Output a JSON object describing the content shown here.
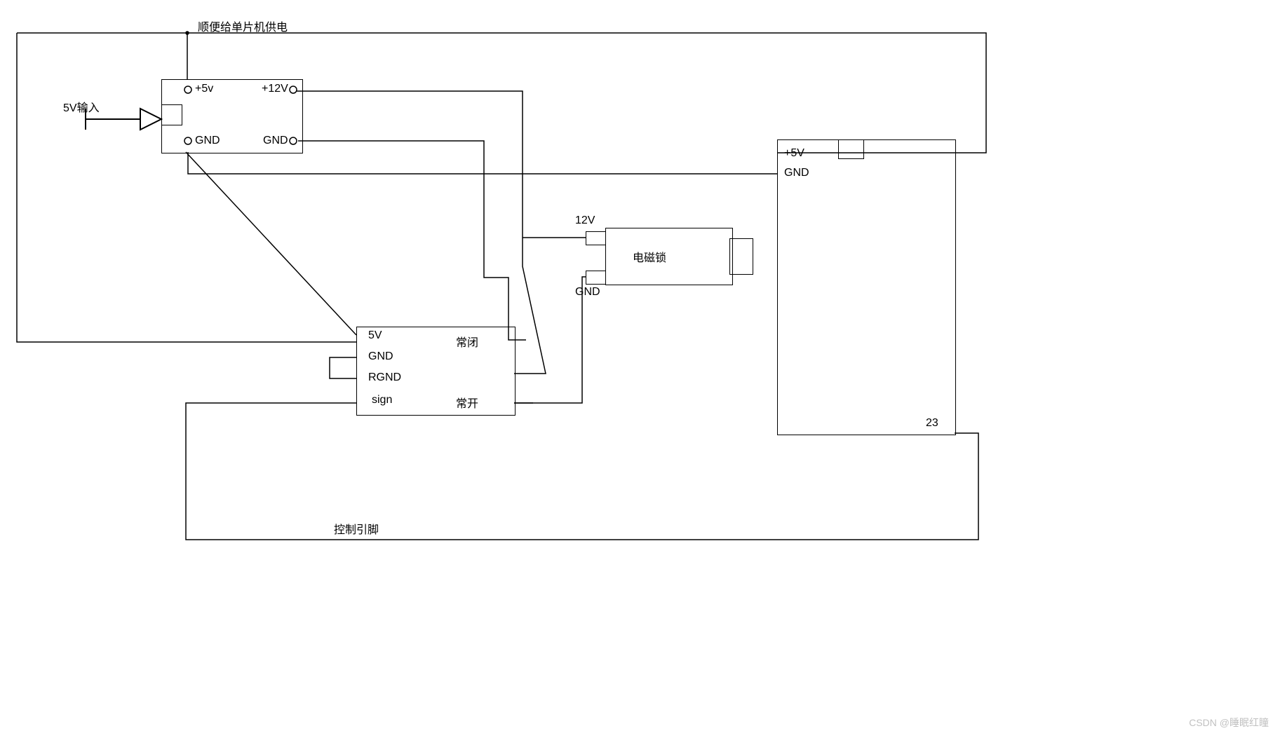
{
  "diagram": {
    "notes": {
      "top_note": "顺便给单片机供电",
      "input_label": "5V输入",
      "control_pin_label": "控制引脚"
    },
    "converter": {
      "pin_in_v": "+5v",
      "pin_in_gnd": "GND",
      "pin_out_v": "+12V",
      "pin_out_gnd": "GND"
    },
    "relay": {
      "pin_5v": "5V",
      "pin_gnd": "GND",
      "pin_rgnd": "RGND",
      "pin_sign": "sign",
      "pin_nc": "常闭",
      "pin_no": "常开"
    },
    "lock": {
      "label": "电磁锁",
      "pin_v": "12V",
      "pin_gnd": "GND"
    },
    "mcu": {
      "pin_5v": "+5V",
      "pin_gnd": "GND",
      "pin_io": "23"
    },
    "watermark": "CSDN @睡眠红瞳"
  }
}
